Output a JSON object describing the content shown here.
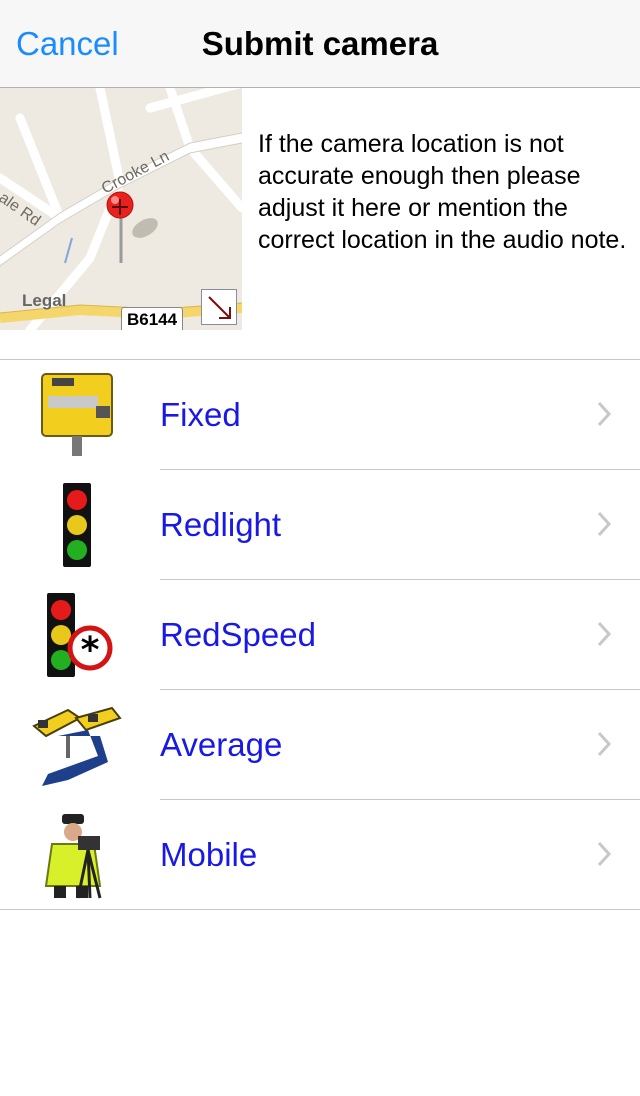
{
  "navbar": {
    "cancel_label": "Cancel",
    "title": "Submit camera"
  },
  "map": {
    "street_labels": [
      "Crooke Ln",
      "ale Rd"
    ],
    "legal_label": "Legal",
    "road_badge": "B6144",
    "pin_color": "#e8201e",
    "expand_icon": "arrow-down-right-icon"
  },
  "info": {
    "text": "If the camera location is not accurate enough then please adjust it here or mention the correct location in the audio note."
  },
  "camera_types": [
    {
      "label": "Fixed",
      "icon": "fixed-camera-icon"
    },
    {
      "label": "Redlight",
      "icon": "traffic-light-icon"
    },
    {
      "label": "RedSpeed",
      "icon": "redspeed-icon"
    },
    {
      "label": "Average",
      "icon": "average-speed-camera-icon"
    },
    {
      "label": "Mobile",
      "icon": "mobile-camera-officer-icon"
    }
  ],
  "colors": {
    "accent": "#1a8cff",
    "row_label": "#1919e6",
    "navbar_bg": "#f7f7f7"
  }
}
